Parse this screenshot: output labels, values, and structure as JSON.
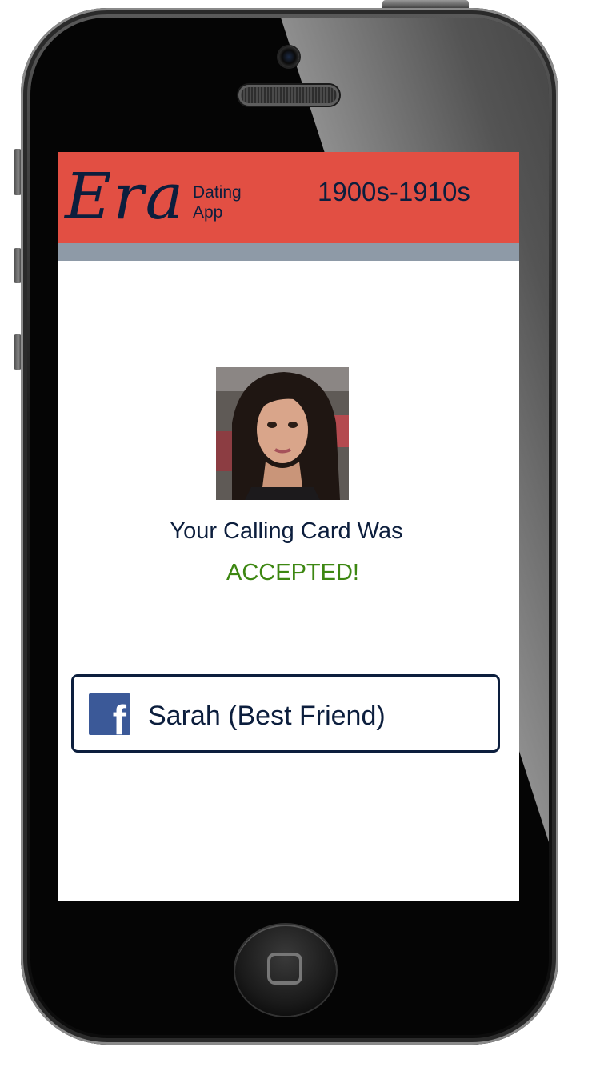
{
  "header": {
    "logo": "Era",
    "logo_sub_line1": "Dating",
    "logo_sub_line2": "App",
    "era_range": "1900s-1910s"
  },
  "main": {
    "status_line": "Your Calling Card Was",
    "status_result": "ACCEPTED!"
  },
  "friend_button": {
    "icon": "facebook-icon",
    "label": "Sarah (Best Friend)"
  },
  "colors": {
    "header_bg": "#e24f43",
    "strip_bg": "#8e9aa7",
    "text_navy": "#0c1e3d",
    "accepted_green": "#3d8712",
    "facebook_blue": "#3b5998"
  }
}
